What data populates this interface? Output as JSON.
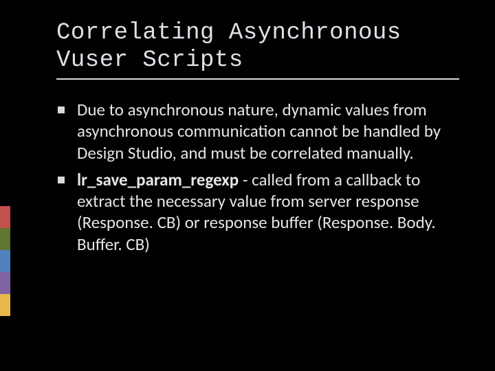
{
  "slide": {
    "title": "Correlating Asynchronous Vuser Scripts",
    "bullets": [
      {
        "text": "Due to asynchronous nature, dynamic values from asynchronous communication cannot be handled by Design Studio, and must be correlated manually."
      },
      {
        "bold": "lr_save_param_regexp",
        "text": " - called from a callback to extract the necessary value from server response (Response. CB) or response buffer (Response. Body. Buffer. CB)"
      }
    ]
  }
}
